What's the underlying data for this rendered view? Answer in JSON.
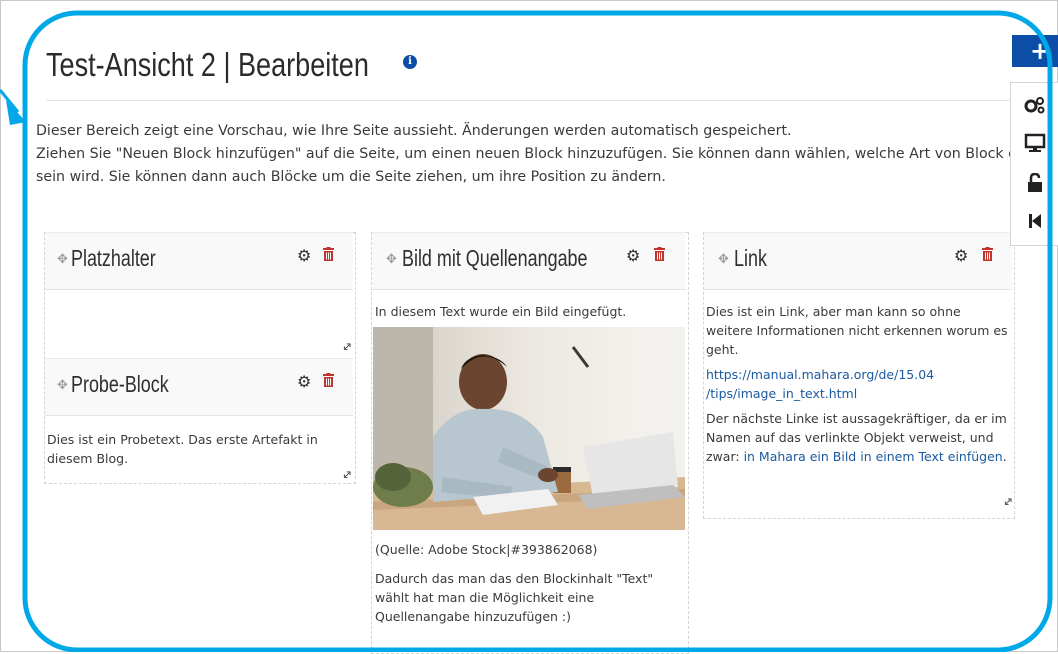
{
  "page": {
    "title": "Test-Ansicht 2 | Bearbeiten",
    "info_icon": "info-icon",
    "intro_line1": "Dieser Bereich zeigt eine Vorschau, wie Ihre Seite aussieht. Änderungen werden automatisch gespeichert.",
    "intro_line2": "Ziehen Sie \"Neuen Block hinzufügen\" auf die Seite, um einen neuen Block hinzuzufügen. Sie können dann wählen, welche Art von Block es sein wird. Sie können dann auch Blöcke um die Seite ziehen, um ihre Position zu ändern."
  },
  "blocks": {
    "placeholder": {
      "title": "Platzhalter"
    },
    "probe": {
      "title": "Probe-Block",
      "text": "Dies ist ein Probetext. Das erste Artefakt in diesem Blog."
    },
    "image": {
      "title": "Bild mit Quellenangabe",
      "caption_top": "In diesem Text wurde ein Bild eingefügt.",
      "source": "(Quelle: Adobe Stock|#393862068)",
      "text": "Dadurch das man das den Blockinhalt \"Text\" wählt hat man die Möglichkeit eine Quellenangabe hinzuzufügen :)"
    },
    "link": {
      "title": "Link",
      "text1": "Dies ist ein Link, aber man kann so ohne weitere Informationen nicht erkennen worum es geht.",
      "url_line1": "https://manual.mahara.org/de/15.04",
      "url_line2": "/tips/image_in_text.html",
      "text2_prefix": "Der nächste Linke ist aussagekräftiger, da er im Namen auf das verlinkte Objekt verweist, und zwar:",
      "link_text": "in Mahara ein Bild in einem Text einfügen",
      "text2_suffix": "."
    }
  },
  "toolbar": {
    "add_icon": "plus-icon",
    "buttons": [
      "settings-icon",
      "display-icon",
      "unlock-icon",
      "return-icon"
    ]
  },
  "colors": {
    "accent": "#0c4ea7",
    "callout": "#00a8e8",
    "delete": "#c0352b",
    "link": "#1a5a9e"
  }
}
